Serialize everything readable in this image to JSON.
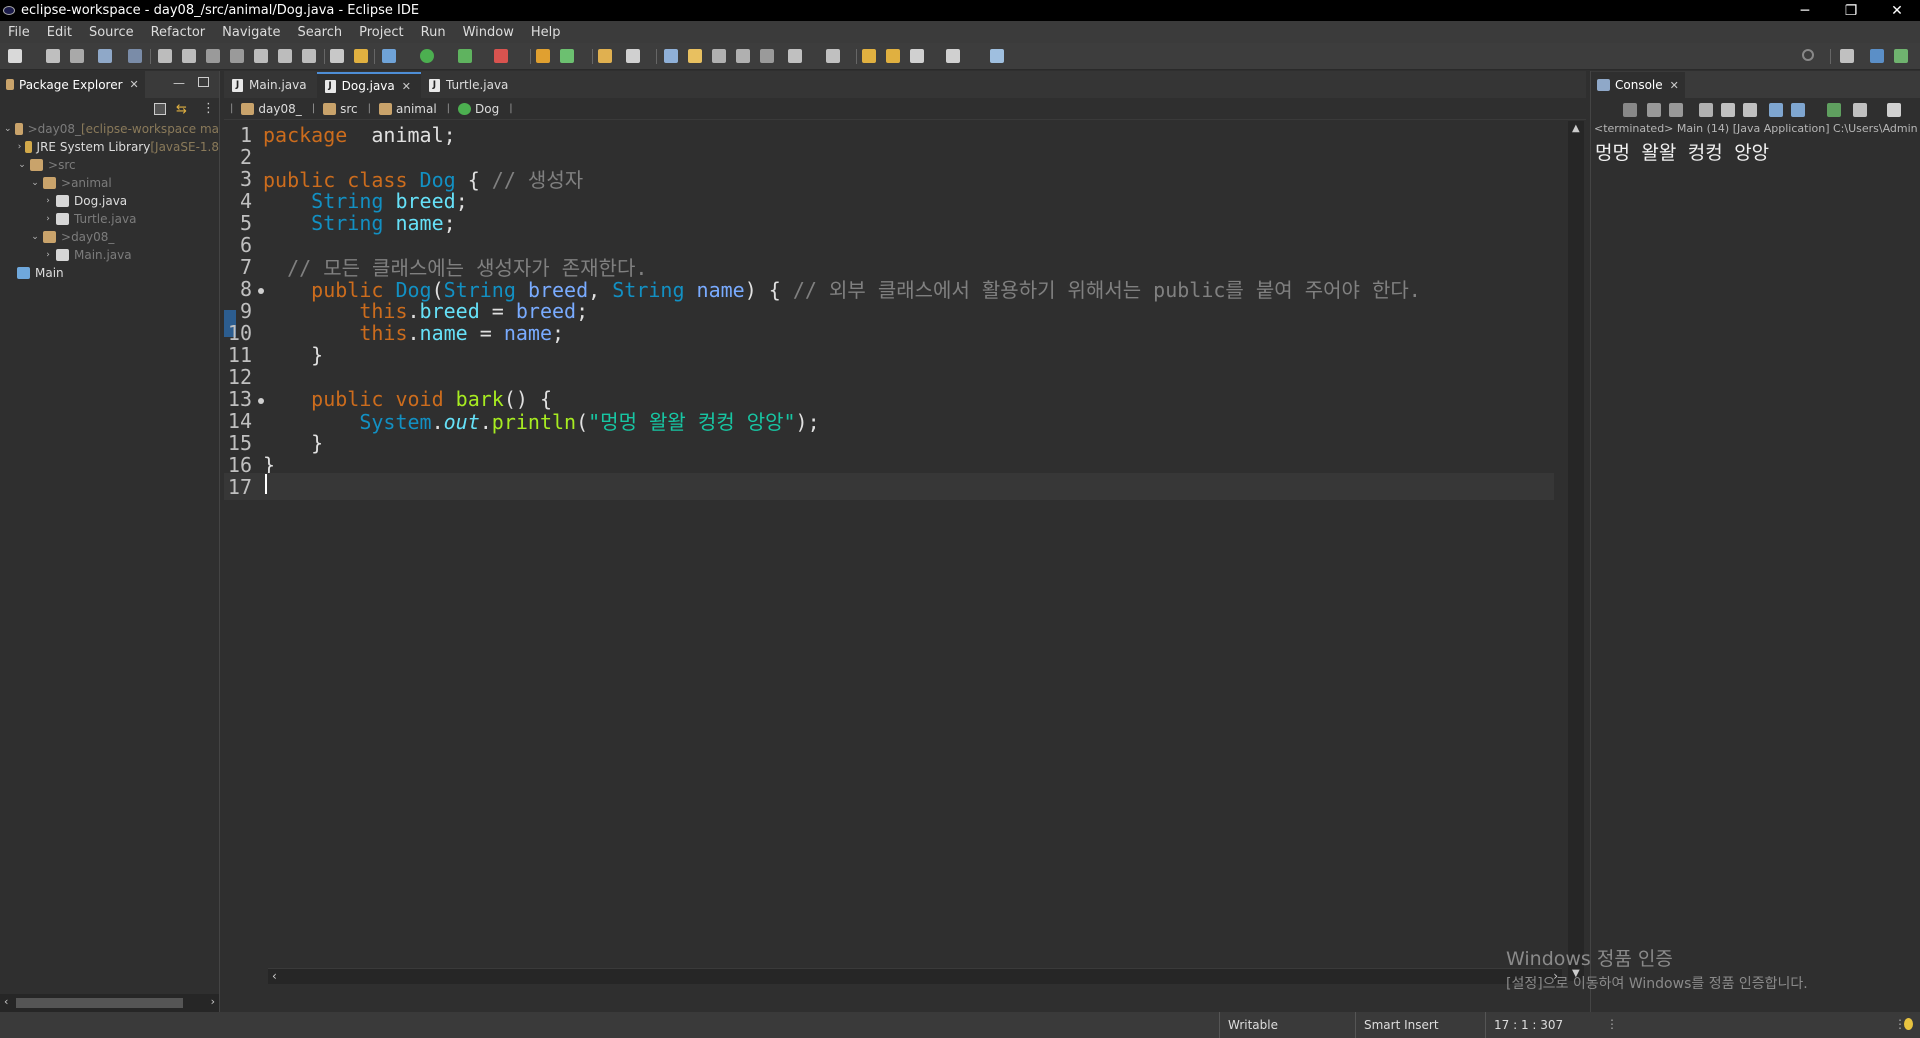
{
  "window": {
    "title": "eclipse-workspace - day08_/src/animal/Dog.java - Eclipse IDE",
    "minimize": "─",
    "restore": "❐",
    "close": "✕"
  },
  "menu": [
    "File",
    "Edit",
    "Source",
    "Refactor",
    "Navigate",
    "Search",
    "Project",
    "Run",
    "Window",
    "Help"
  ],
  "package_explorer": {
    "title": "Package Explorer",
    "tree": [
      {
        "arrow": "v",
        "prefix": "> ",
        "label": "day08_",
        "suffix": " [eclipse-workspace ma",
        "indent": 0,
        "label_dim": true,
        "icon_color": "#c9a36b"
      },
      {
        "arrow": ">",
        "prefix": "",
        "label": "JRE System Library",
        "suffix": " [JavaSE-1.8",
        "indent": 1,
        "label_dim": false,
        "icon_color": "#d2a94a"
      },
      {
        "arrow": "v",
        "prefix": "> ",
        "label": "src",
        "suffix": "",
        "indent": 1,
        "label_dim": true,
        "icon_color": "#c9a36b"
      },
      {
        "arrow": "v",
        "prefix": "> ",
        "label": "animal",
        "suffix": "",
        "indent": 2,
        "label_dim": true,
        "icon_color": "#c9a36b"
      },
      {
        "arrow": ">",
        "prefix": "",
        "label": "Dog.java",
        "suffix": "",
        "indent": 3,
        "label_dim": false,
        "icon_color": "#d6d6d6"
      },
      {
        "arrow": ">",
        "prefix": "",
        "label": "Turtle.java",
        "suffix": "",
        "indent": 3,
        "label_dim": true,
        "icon_color": "#d6d6d6"
      },
      {
        "arrow": "v",
        "prefix": "> ",
        "label": "day08_",
        "suffix": "",
        "indent": 2,
        "label_dim": true,
        "icon_color": "#c9a36b"
      },
      {
        "arrow": ">",
        "prefix": "",
        "label": "Main.java",
        "suffix": "",
        "indent": 3,
        "label_dim": true,
        "icon_color": "#d6d6d6"
      },
      {
        "arrow": "",
        "prefix": "",
        "label": "Main",
        "suffix": "",
        "indent": 0,
        "label_dim": false,
        "icon_color": "#6fa8dc"
      }
    ]
  },
  "editor": {
    "tabs": [
      {
        "label": "Main.java",
        "active": false
      },
      {
        "label": "Dog.java",
        "active": true
      },
      {
        "label": "Turtle.java",
        "active": false
      }
    ],
    "breadcrumb": [
      "day08_",
      "src",
      "animal",
      "Dog"
    ],
    "lines": [
      {
        "n": "1",
        "fold": false,
        "tokens": [
          [
            "kw",
            "package"
          ],
          [
            "",
            "  animal;"
          ]
        ]
      },
      {
        "n": "2",
        "fold": false,
        "tokens": []
      },
      {
        "n": "3",
        "fold": false,
        "tokens": [
          [
            "kw",
            "public class "
          ],
          [
            "ty",
            "Dog"
          ],
          [
            "",
            " { "
          ],
          [
            "cm",
            "// 생성자"
          ]
        ]
      },
      {
        "n": "4",
        "fold": false,
        "tokens": [
          [
            "",
            "    "
          ],
          [
            "ty",
            "String"
          ],
          [
            "",
            " "
          ],
          [
            "fld",
            "breed"
          ],
          [
            "",
            ";"
          ]
        ]
      },
      {
        "n": "5",
        "fold": false,
        "tokens": [
          [
            "",
            "    "
          ],
          [
            "ty",
            "String"
          ],
          [
            "",
            " "
          ],
          [
            "fld",
            "name"
          ],
          [
            "",
            ";"
          ]
        ]
      },
      {
        "n": "6",
        "fold": false,
        "tokens": []
      },
      {
        "n": "7",
        "fold": false,
        "tokens": [
          [
            "",
            "  "
          ],
          [
            "cm",
            "// 모든 클래스에는 생성자가 존재한다."
          ]
        ]
      },
      {
        "n": "8",
        "fold": true,
        "tokens": [
          [
            "",
            "    "
          ],
          [
            "kw",
            "public "
          ],
          [
            "ty",
            "Dog"
          ],
          [
            "",
            "("
          ],
          [
            "ty",
            "String"
          ],
          [
            "",
            " "
          ],
          [
            "prm",
            "breed"
          ],
          [
            "",
            ", "
          ],
          [
            "ty",
            "String"
          ],
          [
            "",
            " "
          ],
          [
            "prm",
            "name"
          ],
          [
            "",
            ") { "
          ],
          [
            "cm",
            "// 외부 클래스에서 활용하기 위해서는 public를 붙여 주어야 한다."
          ]
        ]
      },
      {
        "n": "9",
        "fold": false,
        "tokens": [
          [
            "",
            "        "
          ],
          [
            "kw",
            "this"
          ],
          [
            "",
            "."
          ],
          [
            "fld",
            "breed"
          ],
          [
            "",
            " = "
          ],
          [
            "prm",
            "breed"
          ],
          [
            "",
            ";"
          ]
        ]
      },
      {
        "n": "10",
        "fold": false,
        "tokens": [
          [
            "",
            "        "
          ],
          [
            "kw",
            "this"
          ],
          [
            "",
            "."
          ],
          [
            "fld",
            "name"
          ],
          [
            "",
            " = "
          ],
          [
            "prm",
            "name"
          ],
          [
            "",
            ";"
          ]
        ]
      },
      {
        "n": "11",
        "fold": false,
        "tokens": [
          [
            "",
            "    }"
          ]
        ]
      },
      {
        "n": "12",
        "fold": false,
        "tokens": []
      },
      {
        "n": "13",
        "fold": true,
        "tokens": [
          [
            "",
            "    "
          ],
          [
            "kw",
            "public void "
          ],
          [
            "mth",
            "bark"
          ],
          [
            "",
            "() {"
          ]
        ]
      },
      {
        "n": "14",
        "fold": false,
        "tokens": [
          [
            "",
            "        "
          ],
          [
            "ty",
            "System"
          ],
          [
            "",
            "."
          ],
          [
            "fld it",
            "out"
          ],
          [
            "",
            "."
          ],
          [
            "mth",
            "println"
          ],
          [
            "",
            "("
          ],
          [
            "str",
            "\"멍멍 왈왈 컹컹 앙앙\""
          ],
          [
            "",
            ");"
          ]
        ]
      },
      {
        "n": "15",
        "fold": false,
        "tokens": [
          [
            "",
            "    }"
          ]
        ]
      },
      {
        "n": "16",
        "fold": false,
        "tokens": [
          [
            "",
            "}"
          ]
        ]
      },
      {
        "n": "17",
        "fold": false,
        "tokens": [],
        "current": true
      }
    ]
  },
  "console": {
    "title": "Console",
    "description": "<terminated> Main (14) [Java Application] C:\\Users\\Admin",
    "output": "멍멍 왈왈 컹컹 앙앙"
  },
  "status": {
    "writable": "Writable",
    "insert_mode": "Smart Insert",
    "position": "17 : 1 : 307"
  },
  "watermark": {
    "line1": "Windows 정품 인증",
    "line2": "[설정]으로 이동하여 Windows를 정품 인증합니다."
  }
}
